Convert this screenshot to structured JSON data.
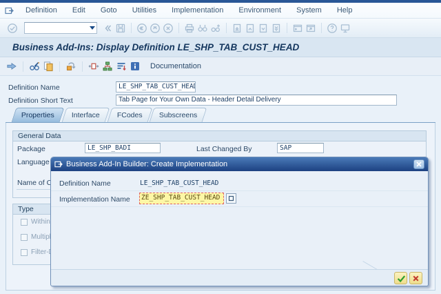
{
  "colors": {
    "top_strip": "#2a5796",
    "dialog_titlebar": "#1c4181",
    "focus_field_bg": "#fdf7a6",
    "focus_field_border": "#e06060",
    "confirm_green": "#2f9e2f",
    "cancel_red": "#c23b2f",
    "active_tab": "#96bbdd"
  },
  "menubar": {
    "items": [
      "Definition",
      "Edit",
      "Goto",
      "Utilities",
      "Implementation",
      "Environment",
      "System",
      "Help"
    ]
  },
  "toolbar": {
    "command_value": ""
  },
  "header": {
    "title": "Business Add-Ins: Display Definition LE_SHP_TAB_CUST_HEAD"
  },
  "app_toolbar": {
    "documentation_label": "Documentation"
  },
  "main": {
    "definition_name_label": "Definition Name",
    "definition_name_value": "LE_SHP_TAB_CUST_HEAD",
    "definition_short_text_label": "Definition Short Text",
    "definition_short_text_value": "Tab Page for Your Own Data - Header Detail Delivery",
    "tabs": [
      "Properties",
      "Interface",
      "FCodes",
      "Subscreens"
    ],
    "active_tab": "Properties",
    "general_data": {
      "title": "General Data",
      "package_label": "Package",
      "package_value": "LE_SHP_BADI",
      "last_changed_by_label": "Last Changed By",
      "last_changed_by_value": "SAP",
      "language_label": "Language",
      "name_of_class_label_partial": "Name of C"
    },
    "type_section": {
      "title": "Type",
      "checkbox_labels_partial": [
        "Within",
        "Multipl",
        "Filter-De"
      ]
    }
  },
  "dialog": {
    "title": "Business Add-In Builder: Create Implementation",
    "definition_name_label": "Definition Name",
    "definition_name_value": "LE_SHP_TAB_CUST_HEAD",
    "implementation_name_label": "Implementation Name",
    "implementation_name_value": "ZE_SHP_TAB_CUST_HEAD"
  }
}
